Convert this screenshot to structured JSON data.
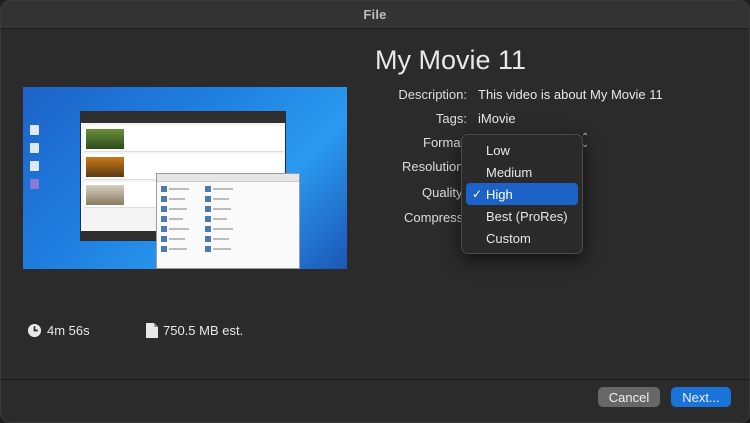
{
  "window": {
    "title": "File"
  },
  "movie": {
    "title": "My Movie 11",
    "description_label": "Description:",
    "description": "This video is about My Movie 11",
    "tags_label": "Tags:",
    "tags": "iMovie",
    "format_label": "Format:",
    "resolution_label": "Resolution:",
    "quality_label": "Quality:",
    "compress_label": "Compress:"
  },
  "quality_menu": {
    "options": [
      "Low",
      "Medium",
      "High",
      "Best (ProRes)",
      "Custom"
    ],
    "selected": "High",
    "check_glyph": "✓"
  },
  "info": {
    "duration": "4m 56s",
    "size": "750.5 MB est."
  },
  "buttons": {
    "cancel": "Cancel",
    "next": "Next..."
  },
  "colors": {
    "accent": "#1a73d8",
    "selection": "#1d63c7",
    "window_bg": "#2b2b2b"
  }
}
